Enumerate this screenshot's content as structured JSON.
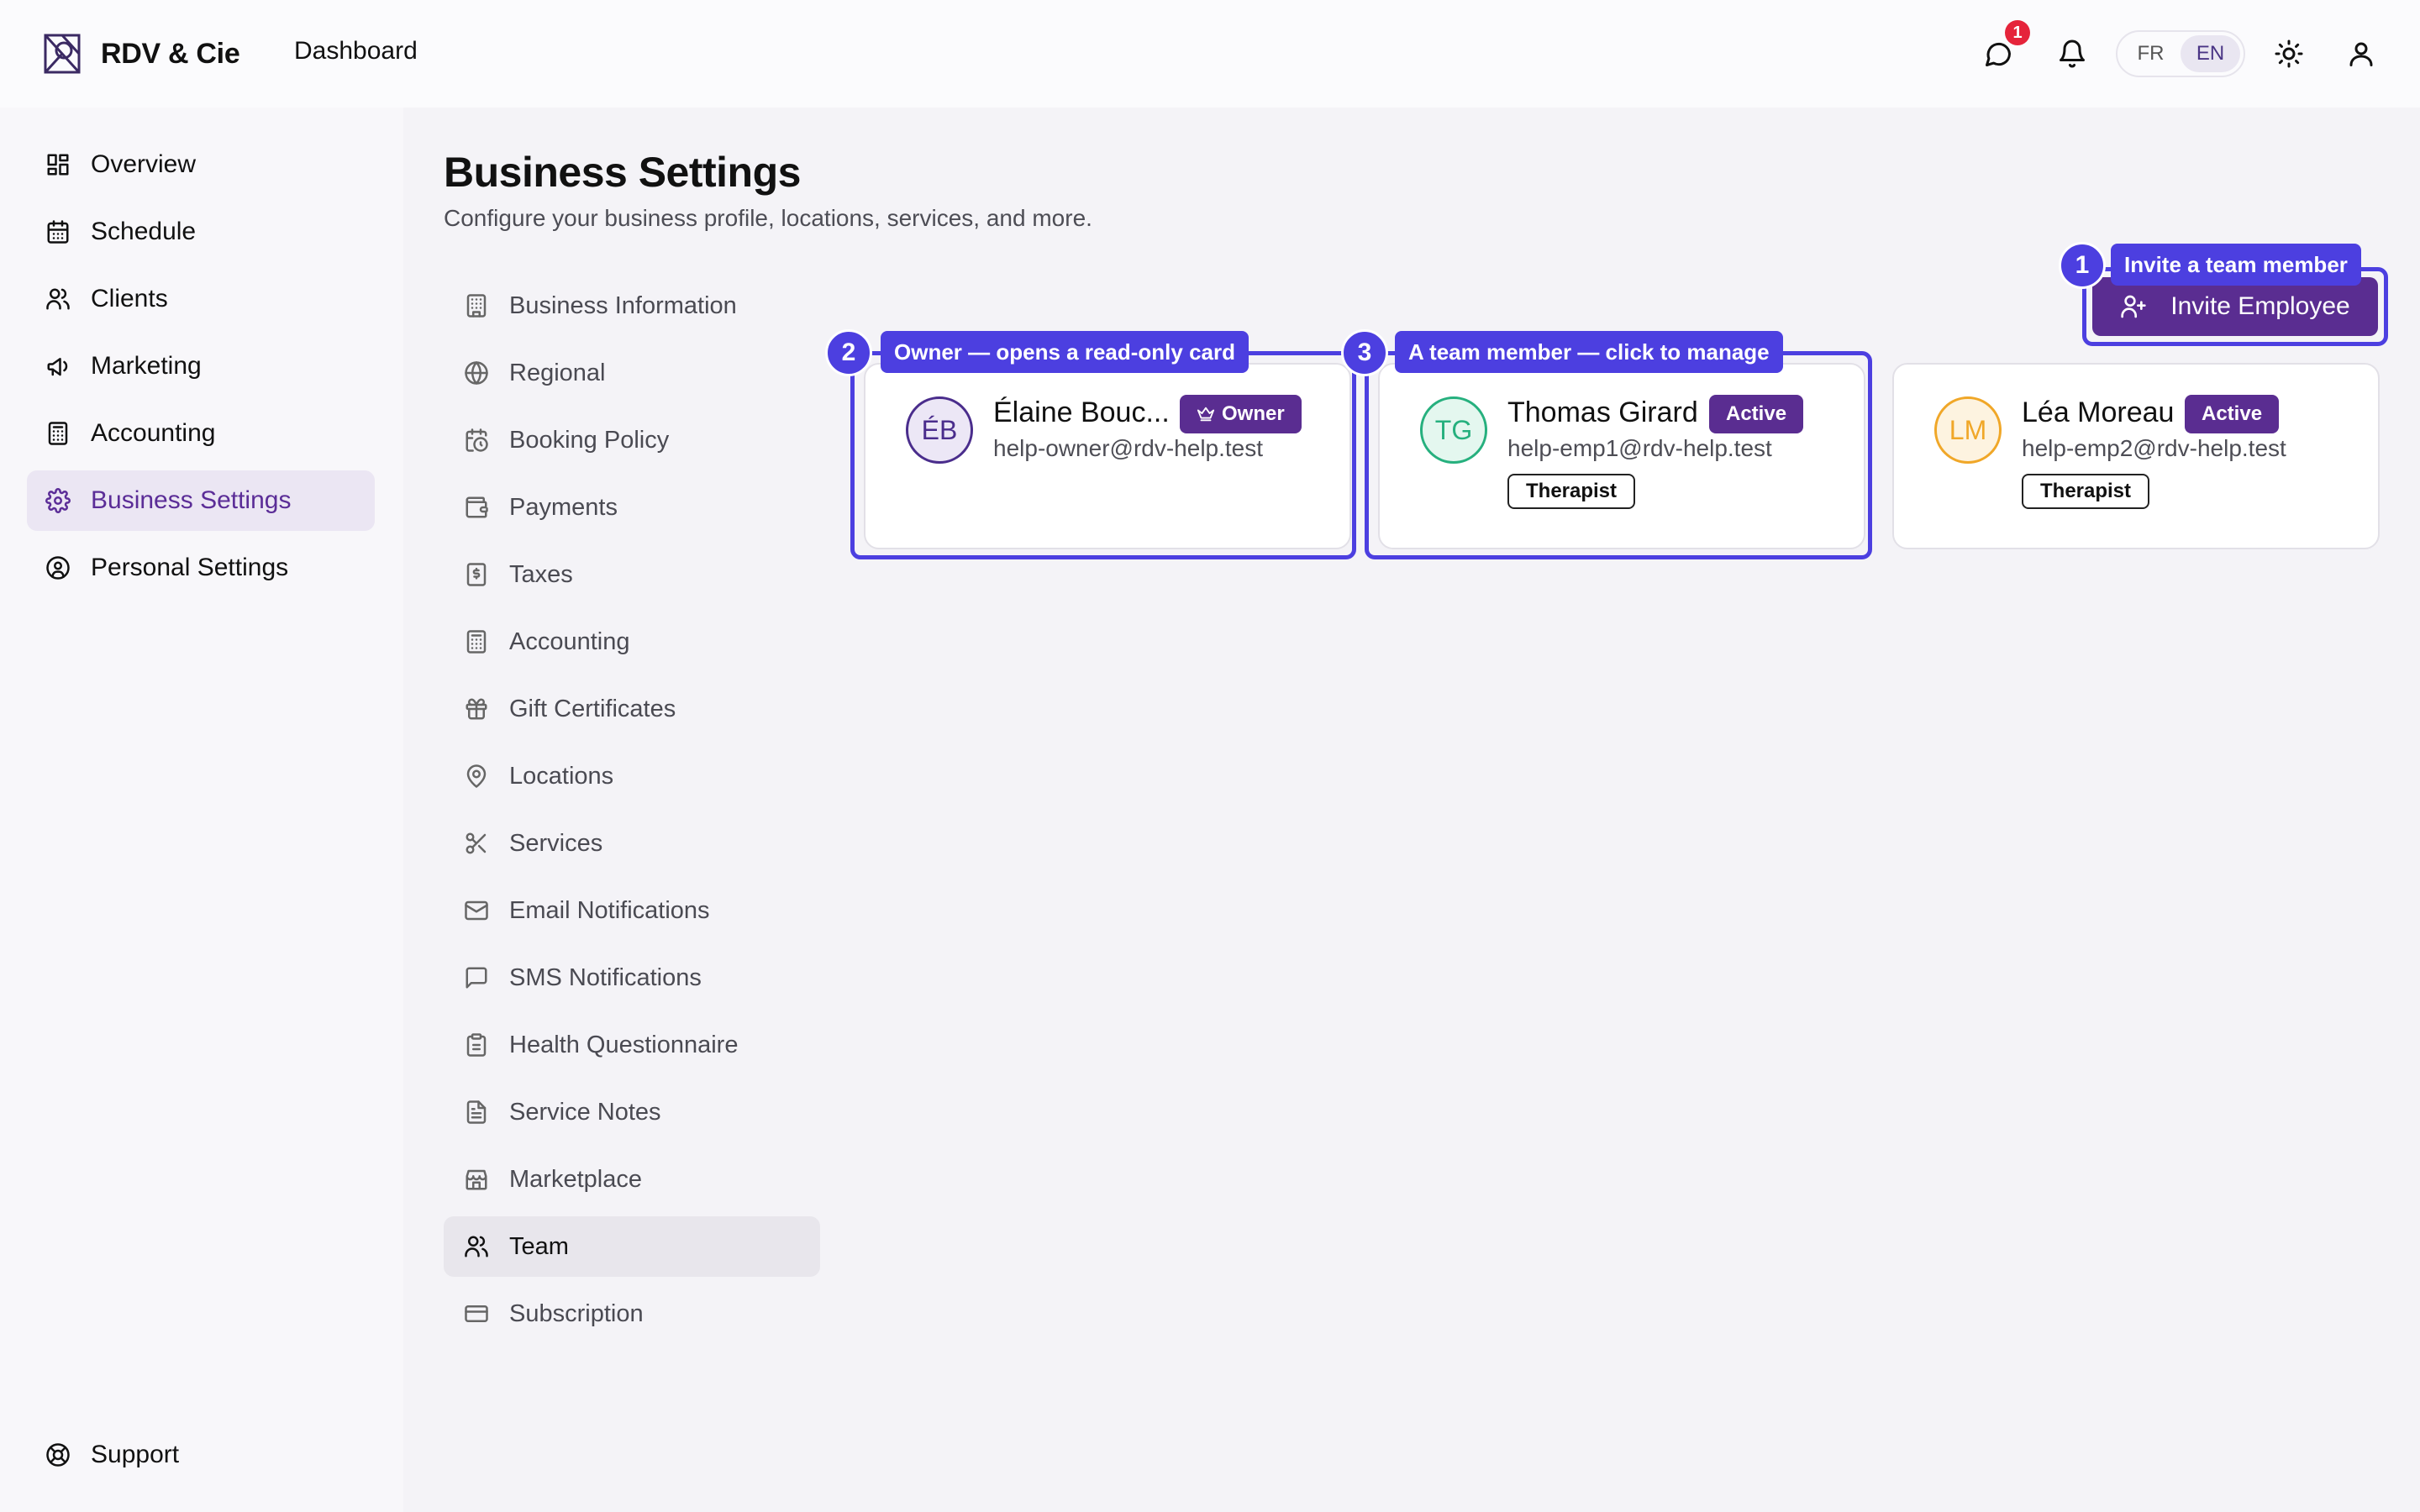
{
  "app": {
    "name": "RDV & Cie",
    "top_link": "Dashboard",
    "messages_badge": "1",
    "languages": [
      "FR",
      "EN"
    ],
    "active_language": "EN"
  },
  "sidebar": {
    "items": [
      {
        "label": "Overview",
        "icon": "grid-icon"
      },
      {
        "label": "Schedule",
        "icon": "calendar-icon"
      },
      {
        "label": "Clients",
        "icon": "users-icon"
      },
      {
        "label": "Marketing",
        "icon": "megaphone-icon"
      },
      {
        "label": "Accounting",
        "icon": "calculator-icon"
      },
      {
        "label": "Business Settings",
        "icon": "gear-icon"
      },
      {
        "label": "Personal Settings",
        "icon": "user-circle-icon"
      }
    ],
    "active": "Business Settings",
    "support_label": "Support"
  },
  "page": {
    "title": "Business Settings",
    "subtitle": "Configure your business profile, locations, services, and more."
  },
  "settings_nav": {
    "items": [
      "Business Information",
      "Regional",
      "Booking Policy",
      "Payments",
      "Taxes",
      "Accounting",
      "Gift Certificates",
      "Locations",
      "Services",
      "Email Notifications",
      "SMS Notifications",
      "Health Questionnaire",
      "Service Notes",
      "Marketplace",
      "Team",
      "Subscription"
    ],
    "active": "Team"
  },
  "team": {
    "invite_label": "Invite Employee",
    "members": [
      {
        "initials": "ÉB",
        "name": "Élaine Bouc...",
        "email": "help-owner@rdv-help.test",
        "status": "Owner",
        "role": ""
      },
      {
        "initials": "TG",
        "name": "Thomas Girard",
        "email": "help-emp1@rdv-help.test",
        "status": "Active",
        "role": "Therapist"
      },
      {
        "initials": "LM",
        "name": "Léa Moreau",
        "email": "help-emp2@rdv-help.test",
        "status": "Active",
        "role": "Therapist"
      }
    ]
  },
  "callouts": [
    {
      "number": "1",
      "text": "Invite a team member"
    },
    {
      "number": "2",
      "text": "Owner — opens a read-only card"
    },
    {
      "number": "3",
      "text": "A team member — click to manage"
    }
  ],
  "colors": {
    "brand_purple": "#5a2d91",
    "callout_blue": "#4c3fe0",
    "notification_red": "#e5243b"
  }
}
